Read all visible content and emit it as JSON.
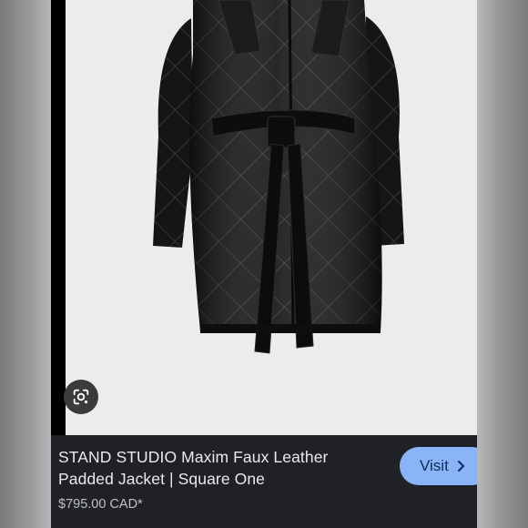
{
  "result": {
    "title_line1": "STAND STUDIO Maxim Faux Leather",
    "title_line2": "Padded Jacket | Square One",
    "price": "$795.00 CAD*",
    "visit_label": "Visit"
  },
  "icons": {
    "lens": "google-lens-icon",
    "visit_chevron": "chevron-right-icon"
  },
  "colors": {
    "panel_background": "#202124",
    "image_background": "#ececec",
    "visit_button": "#8ab4f8",
    "title_text": "#e8eaed",
    "price_text": "#bdc1c6"
  }
}
